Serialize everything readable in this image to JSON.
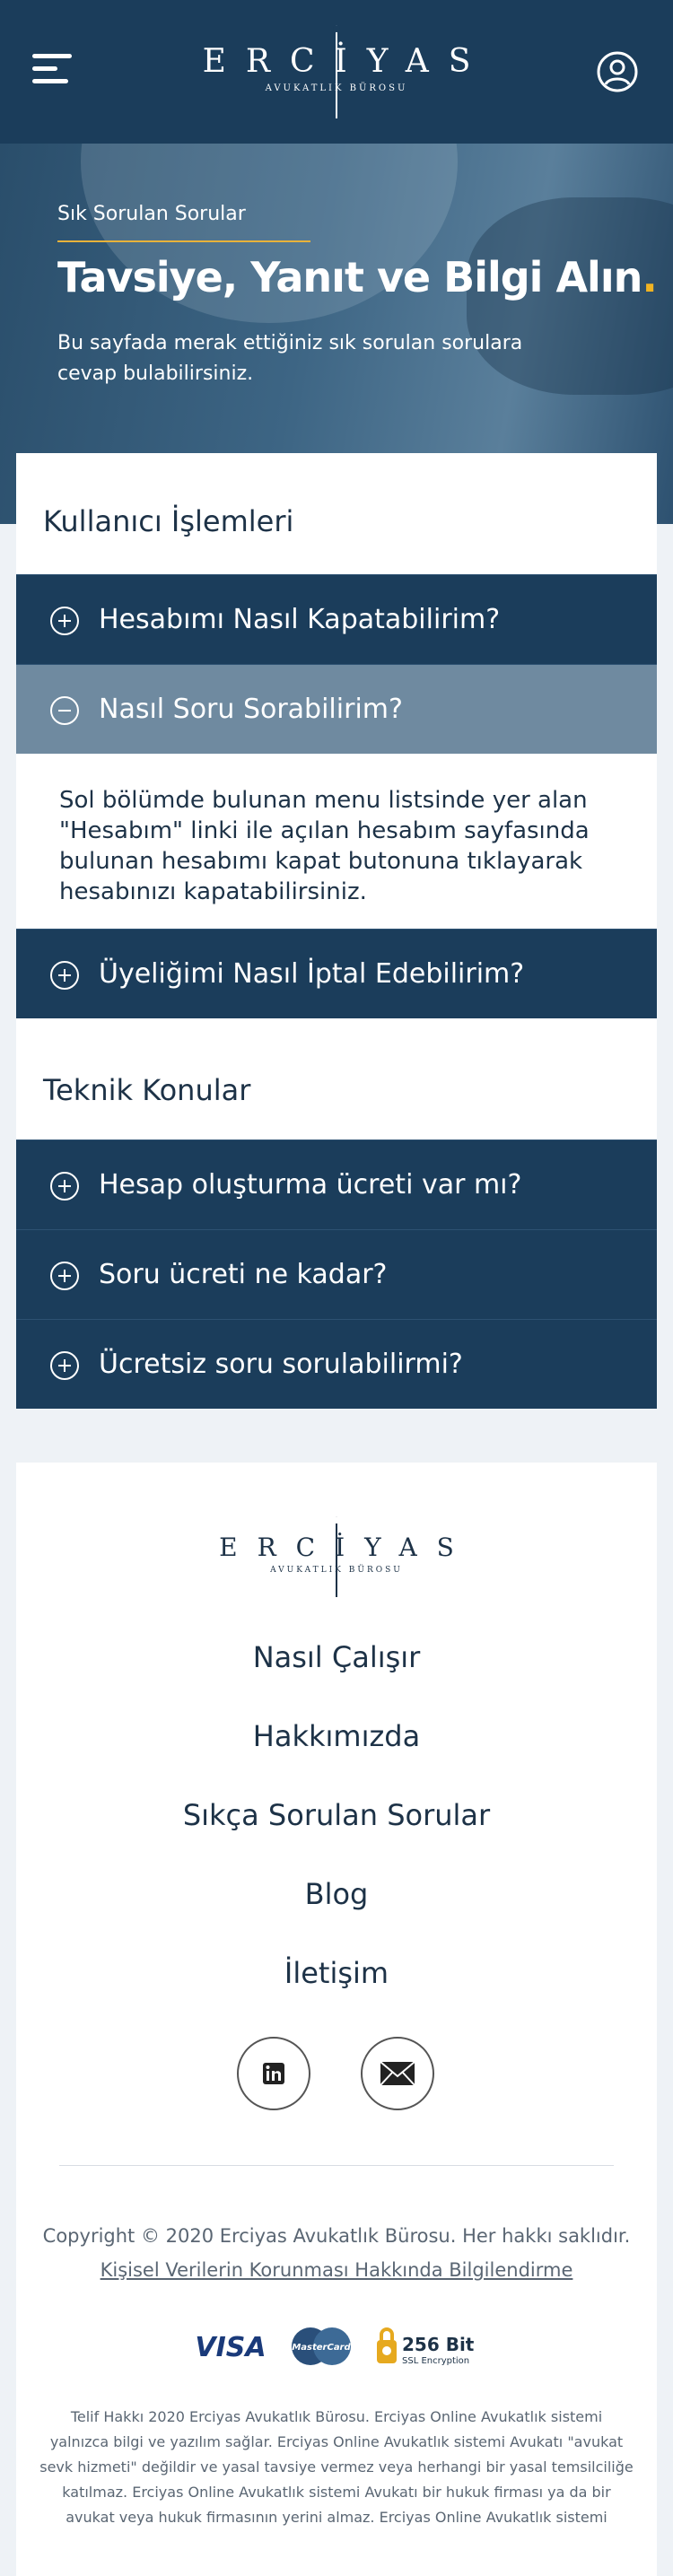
{
  "header": {
    "logo_word": "ERCİYAS",
    "logo_sub": "AVUKATLIK BÜROSU",
    "menu_icon": "hamburger-menu-icon",
    "user_icon": "user-circle-icon"
  },
  "hero": {
    "kicker": "Sık Sorulan Sorular",
    "title": "Tavsiye, Yanıt ve Bilgi Alın",
    "title_dot": ".",
    "description": "Bu sayfada merak ettiğiniz sık sorulan sorulara cevap bulabilirsiniz."
  },
  "sections": [
    {
      "title": "Kullanıcı İşlemleri",
      "items": [
        {
          "question": "Hesabımı Nasıl Kapatabilirim?",
          "state": "collapsed"
        },
        {
          "question": "Nasıl Soru Sorabilirim?",
          "state": "expanded",
          "answer": "Sol bölümde bulunan menu listsinde yer alan \"Hesabım\" linki ile açılan hesabım sayfasında bulunan hesabımı kapat butonuna tıklayarak hesabınızı kapatabilirsiniz."
        },
        {
          "question": "Üyeliğimi Nasıl İptal Edebilirim?",
          "state": "collapsed"
        }
      ]
    },
    {
      "title": "Teknik Konular",
      "items": [
        {
          "question": "Hesap oluşturma ücreti var mı?",
          "state": "collapsed"
        },
        {
          "question": "Soru ücreti ne kadar?",
          "state": "collapsed"
        },
        {
          "question": "Ücretsiz soru sorulabilirmi?",
          "state": "collapsed"
        }
      ]
    }
  ],
  "footer": {
    "nav": [
      "Nasıl Çalışır",
      "Hakkımızda",
      "Sıkça Sorulan Sorular",
      "Blog",
      "İletişim"
    ],
    "social": [
      "linkedin-icon",
      "mail-icon"
    ],
    "copyright": "Copyright © 2020 Erciyas Avukatlık Bürosu. Her hakkı saklıdır.",
    "kvkk_link": "Kişisel Verilerin Korunması Hakkında Bilgilendirme",
    "payment": {
      "visa": "VISA",
      "mastercard": "MasterCard",
      "ssl_title": "256 Bit",
      "ssl_sub": "SSL Encryption"
    },
    "legal": "Telif Hakkı 2020 Erciyas Avukatlık Bürosu. Erciyas Online Avukatlık sistemi yalnızca bilgi ve yazılım sağlar. Erciyas Online Avukatlık sistemi Avukatı \"avukat sevk hizmeti\" değildir ve yasal tavsiye vermez veya herhangi bir yasal temsilciliğe katılmaz. Erciyas Online Avukatlık sistemi Avukatı bir hukuk firması ya da bir avukat veya hukuk firmasının yerini almaz. Erciyas Online Avukatlık sistemi"
  },
  "colors": {
    "primary": "#1b3d5b",
    "expanded": "#6f8aa0",
    "accent": "#f0b323",
    "background": "#eef2f6"
  }
}
